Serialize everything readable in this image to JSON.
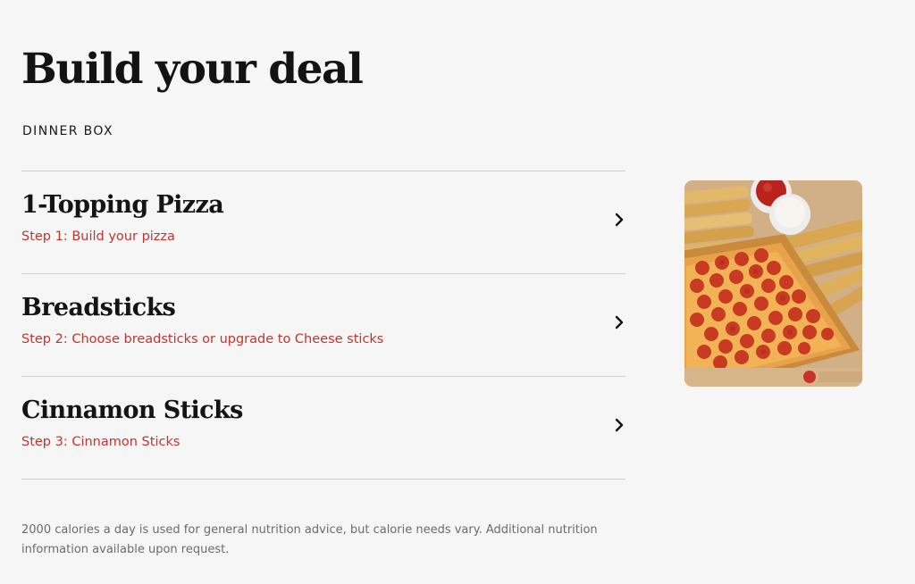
{
  "page": {
    "title": "Build your deal",
    "subtitle": "DINNER BOX"
  },
  "steps": [
    {
      "name": "1-Topping Pizza",
      "description": "Step 1: Build your pizza",
      "icon": "chevron-right-icon"
    },
    {
      "name": "Breadsticks",
      "description": "Step 2: Choose breadsticks or upgrade to Cheese sticks",
      "icon": "chevron-right-icon"
    },
    {
      "name": "Cinnamon Sticks",
      "description": "Step 3: Cinnamon Sticks",
      "icon": "chevron-right-icon"
    }
  ],
  "image": {
    "subject": "dinner-box-photo"
  },
  "footnote": "2000 calories a day is used for general nutrition advice, but calorie needs vary. Additional nutrition information available upon request.",
  "colors": {
    "background": "#f6f6f6",
    "accent": "#c8322c",
    "text": "#141414",
    "divider": "#cfcfcf"
  }
}
